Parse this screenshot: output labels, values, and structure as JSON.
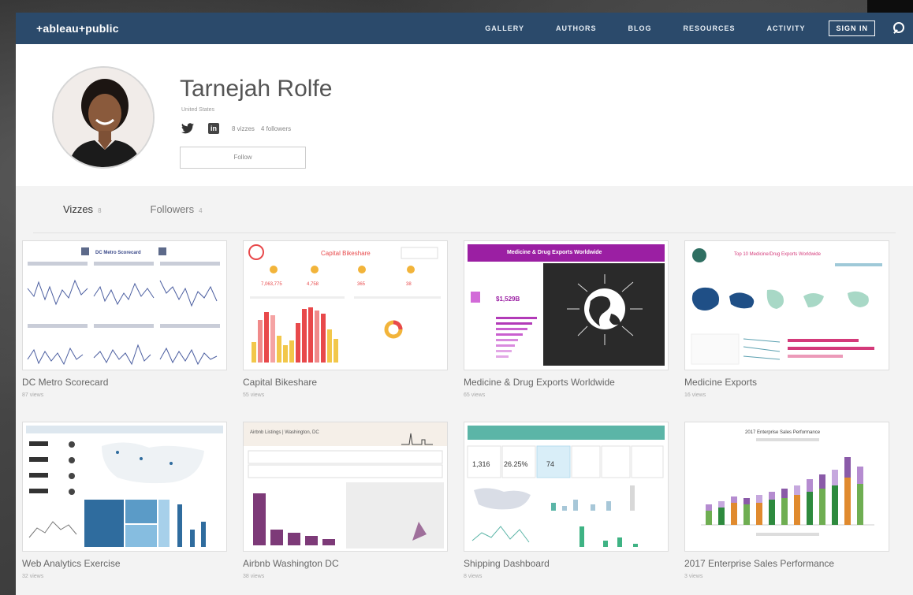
{
  "nav": {
    "logo": "+ableau+public",
    "links": [
      "GALLERY",
      "AUTHORS",
      "BLOG",
      "RESOURCES",
      "ACTIVITY"
    ],
    "signin": "SIGN IN"
  },
  "profile": {
    "name": "Tarnejah Rolfe",
    "location": "United States",
    "vizzes_stat": "8 vizzes",
    "followers_stat": "4 followers",
    "follow_label": "Follow"
  },
  "tabs": [
    {
      "label": "Vizzes",
      "count": "8"
    },
    {
      "label": "Followers",
      "count": "4"
    }
  ],
  "vizzes": [
    {
      "title": "DC Metro Scorecard",
      "views": "87 views",
      "thumb_heading": "DC Metro Scorecard"
    },
    {
      "title": "Capital Bikeshare",
      "views": "55 views",
      "thumb_heading": "Capital Bikeshare",
      "kpis": [
        "7,063,775",
        "4,758",
        "365",
        "38"
      ]
    },
    {
      "title": "Medicine & Drug Exports Worldwide",
      "views": "65 views",
      "thumb_heading": "Medicine & Drug Exports Worldwide",
      "kpis": [
        "$1,529B"
      ]
    },
    {
      "title": "Medicine Exports",
      "views": "16 views",
      "thumb_heading": "Top 10 Medicine/Drug Exports Worldwide"
    },
    {
      "title": "Web Analytics Exercise",
      "views": "32 views"
    },
    {
      "title": "Airbnb Washington DC",
      "views": "38 views",
      "thumb_heading": "Airbnb Listings | Washington, DC"
    },
    {
      "title": "Shipping Dashboard",
      "views": "8 views",
      "kpis": [
        "1,316",
        "26.25%",
        "74"
      ]
    },
    {
      "title": "2017 Enterprise Sales Performance",
      "views": "3 views",
      "thumb_heading": "2017 Enterprise Sales Performance"
    }
  ],
  "colors": {
    "nav_bg": "#2b4a6b",
    "bikeshare_accent": "#e8494b",
    "medicine_purple": "#9b1fa3",
    "web_analytics_blue": "#2f6c9e",
    "airbnb_purple": "#7d3a78",
    "shipping_teal": "#5bb5a7"
  }
}
